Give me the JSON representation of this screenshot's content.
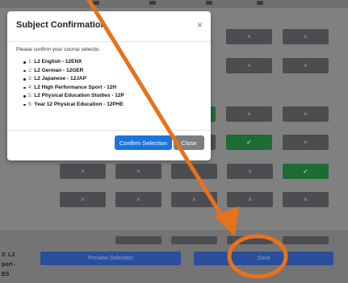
{
  "modal": {
    "title": "Subject Confirmation",
    "close_glyph": "×",
    "prompt": "Please confirm your course selectio",
    "courses": [
      {
        "num": "1:",
        "name": "L2 English - 12ENX"
      },
      {
        "num": "2:",
        "name": "L2 German - 12GER"
      },
      {
        "num": "3:",
        "name": "L2 Japanese - 12JAP"
      },
      {
        "num": "4:",
        "name": "L2 High Performance Sport - 12H"
      },
      {
        "num": "5:",
        "name": "L2 Physical Education Studies - 12P"
      },
      {
        "num": "6:",
        "name": "Year 12 Physical Education - 12PHE"
      }
    ],
    "confirm_label": "Confirm Selection",
    "close_label": "Close"
  },
  "grid": {
    "off_glyph": "×",
    "on_glyph": "✓"
  },
  "background": {
    "side_text_1": "3: L2",
    "side_text_2": "port -",
    "side_text_3": "ES"
  },
  "footer": {
    "preview_label": "Preview Selection",
    "save_label": "Save"
  },
  "colors": {
    "annotation_orange": "#e8711c",
    "confirm_blue": "#1a74e0",
    "toggle_on_green": "#1f6b34"
  }
}
